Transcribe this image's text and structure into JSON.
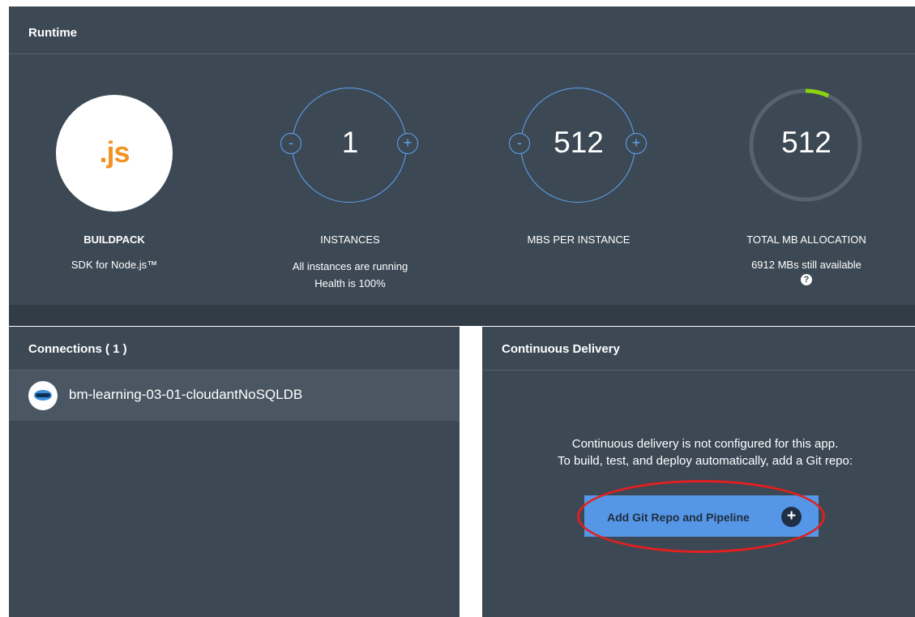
{
  "runtime": {
    "title": "Runtime",
    "buildpack": {
      "logo_text": ".js",
      "label": "BUILDPACK",
      "sub": "SDK for Node.js™"
    },
    "instances": {
      "value": "1",
      "minus": "-",
      "plus": "+",
      "label": "INSTANCES",
      "sub_lines": [
        "All instances are running",
        "Health is 100%"
      ]
    },
    "memory": {
      "value": "512",
      "minus": "-",
      "plus": "+",
      "label": "MBS PER INSTANCE"
    },
    "total": {
      "value": "512",
      "label": "TOTAL MB ALLOCATION",
      "sub": "6912 MBs still available",
      "help_icon": "?",
      "allocation_fraction": 0.069
    }
  },
  "connections": {
    "title": "Connections ( 1 )",
    "items": [
      {
        "label": "bm-learning-03-01-cloudantNoSQLDB",
        "icon": "cloudant-icon"
      }
    ]
  },
  "delivery": {
    "title": "Continuous Delivery",
    "message_lines": [
      "Continuous delivery is not configured for this app.",
      "To build, test, and deploy automatically, add a Git repo:"
    ],
    "button_label": "Add Git Repo and Pipeline",
    "button_icon": "+"
  },
  "colors": {
    "panel": "#3c4955",
    "accent_blue": "#5fa4f2",
    "button_blue": "#5596e6",
    "progress_green": "#8cd211",
    "annotation_red": "#e02020",
    "nodejs_orange": "#f29424"
  }
}
